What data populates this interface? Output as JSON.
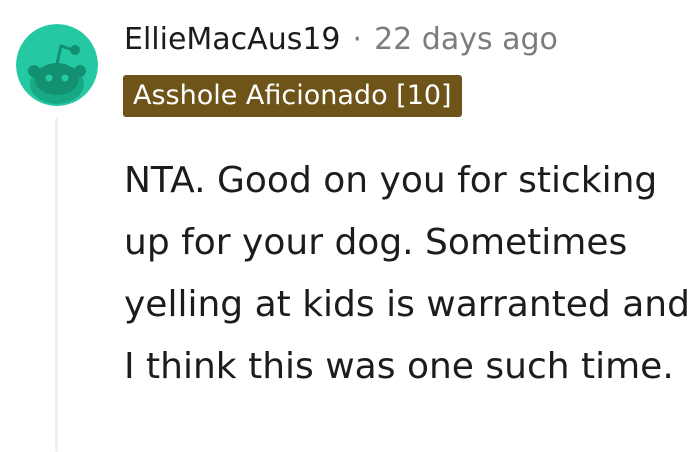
{
  "comment": {
    "avatar_icon": "snoo-avatar-icon",
    "avatar_color": "#24c9a3",
    "username": "EllieMacAus19",
    "separator": "·",
    "timestamp": "22 days ago",
    "flair": {
      "text": "Asshole Aficionado [10]",
      "background": "#6e5418",
      "color": "#ffffff"
    },
    "body": "NTA. Good on you for sticking up for your dog. Sometimes yelling at kids is warranted and I think this was one such time."
  }
}
